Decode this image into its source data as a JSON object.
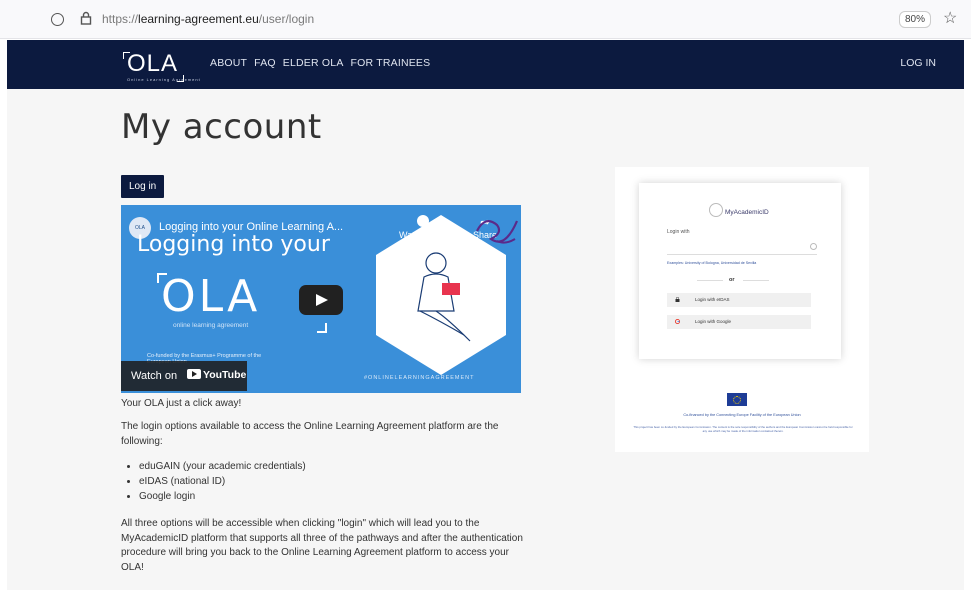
{
  "browser": {
    "url_prefix": "https://",
    "url_domain": "learning-agreement.eu",
    "url_path": "/user/login",
    "zoom": "80%"
  },
  "nav": {
    "logo": "OLA",
    "logo_tagline": "Online Learning Agreement",
    "links": [
      "ABOUT",
      "FAQ",
      "ELDER OLA",
      "FOR TRAINEES"
    ],
    "login": "LOG IN"
  },
  "page": {
    "title": "My account",
    "tab": "Log in"
  },
  "video": {
    "channel_badge": "OLA",
    "title": "Logging into your Online Learning A...",
    "headline": "Logging into your",
    "big_text": "OLA",
    "subtitle": "online learning agreement",
    "watch_later": "Watch Later",
    "share": "Share",
    "cofunded": "Co-funded by the Erasmus+ Programme of the European Union",
    "hashtag": "#ONLINELEARNINGAGREEMENT",
    "watch_on": "Watch on",
    "youtube": "YouTube"
  },
  "body": {
    "p1": "Your OLA just a click away!",
    "p2": "The login options available to access the Online Learning Agreement platform are the following:",
    "items": [
      "eduGAIN (your academic credentials)",
      "eIDAS (national ID)",
      "Google login"
    ],
    "p3": "All three options will be accessible when clicking \"login\" which will lead you to the MyAcademicID platform that supports all three of the pathways and after the authentication procedure will bring you back to the Online Learning Agreement platform to access your OLA!"
  },
  "myacademicid": {
    "brand": "MyAcademicID",
    "login_with": "Login with",
    "examples": "Examples: University of Bologna, Universidad de Sevilla",
    "or": "or",
    "btn_eidas": "Login with eIDAS",
    "btn_google": "Login with Google",
    "eu_line": "Co-financed by the Connecting Europe Facility of the European Union",
    "eu_disclaimer": "This project has been co-funded by the European Commission. The content is the sole responsibility of the authors and the European Commission cannot be held responsible for any use which may be made of the information contained therein."
  },
  "colors": {
    "navy": "#0c1a3f",
    "video_blue": "#3a8fd9"
  }
}
